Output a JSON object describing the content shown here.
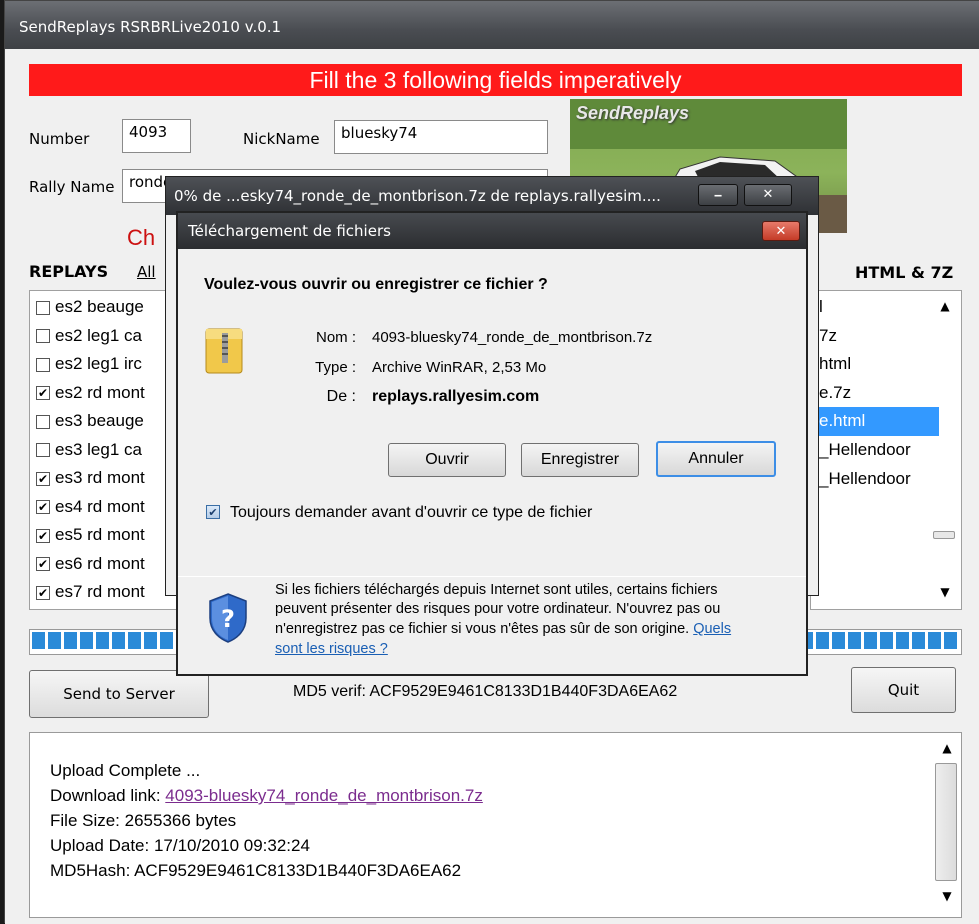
{
  "main": {
    "title": "SendReplays RSRBRLive2010 v.0.1",
    "banner": "Fill the 3 following fields imperatively",
    "number_label": "Number",
    "number_value": "4093",
    "nickname_label": "NickName",
    "nickname_value": "bluesky74",
    "rally_label": "Rally Name",
    "rally_value": "ronde",
    "red_partial": "Ch",
    "replays_label": "REPLAYS",
    "all_link": "All",
    "htmlz_label": "HTML & 7Z",
    "photo_caption": "SendReplays",
    "colors": {
      "banner": "#ff1a1a",
      "selection": "#3399ff",
      "progress": "#2a8ad8"
    }
  },
  "replays": [
    {
      "label": "es2 beauge",
      "checked": false
    },
    {
      "label": "es2 leg1 ca",
      "checked": false
    },
    {
      "label": "es2 leg1 irc",
      "checked": false
    },
    {
      "label": "es2 rd mont",
      "checked": true
    },
    {
      "label": "es3 beauge",
      "checked": false
    },
    {
      "label": "es3 leg1 ca",
      "checked": false
    },
    {
      "label": "es3 rd mont",
      "checked": true
    },
    {
      "label": "es4 rd mont",
      "checked": true
    },
    {
      "label": "es5 rd mont",
      "checked": true
    },
    {
      "label": "es6 rd mont",
      "checked": true
    },
    {
      "label": "es7 rd mont",
      "checked": true
    }
  ],
  "html_files": [
    {
      "label": "l",
      "selected": false
    },
    {
      "label": "7z",
      "selected": false
    },
    {
      "label": "html",
      "selected": false
    },
    {
      "label": "e.7z",
      "selected": false
    },
    {
      "label": "e.html",
      "selected": true
    },
    {
      "label": "_Hellendoor",
      "selected": false
    },
    {
      "label": "_Hellendoor",
      "selected": false
    }
  ],
  "progress": {
    "fraction": 1.0
  },
  "send_button": "Send to Server",
  "md5_verif": "MD5 verif: ACF9529E9461C8133D1B440F3DA6EA62",
  "quit_button": "Quit",
  "output": {
    "line1": "Upload Complete ...",
    "link_label": "Download link: ",
    "link_text": "4093-bluesky74_ronde_de_montbrison.7z",
    "line3": "File Size: 2655366 bytes",
    "line4": "Upload Date: 17/10/2010 09:32:24",
    "line5": "MD5Hash: ACF9529E9461C8133D1B440F3DA6EA62"
  },
  "download_window": {
    "title": "0% de ...esky74_ronde_de_montbrison.7z de replays.rallyesim....",
    "minimize": "‒",
    "close": "✕"
  },
  "file_dialog": {
    "title": "Téléchargement de fichiers",
    "close": "✕",
    "question": "Voulez-vous ouvrir ou enregistrer ce fichier ?",
    "name_label": "Nom :",
    "name_value": "4093-bluesky74_ronde_de_montbrison.7z",
    "type_label": "Type :",
    "type_value": "Archive WinRAR, 2,53 Mo",
    "from_label": "De :",
    "from_value": "replays.rallyesim.com",
    "open_button": "Ouvrir",
    "save_button": "Enregistrer",
    "cancel_button": "Annuler",
    "always_ask": "Toujours demander avant d'ouvrir ce type de fichier",
    "always_ask_checked": true,
    "warning_1": "Si les fichiers téléchargés depuis Internet sont utiles, certains fichiers",
    "warning_2": "peuvent présenter des risques pour votre ordinateur. N'ouvrez pas ou",
    "warning_3": "n'enregistrez pas ce fichier si vous n'êtes pas sûr de son origine.",
    "risks_link_1": "Quels",
    "risks_link_2": "sont les risques ?"
  }
}
